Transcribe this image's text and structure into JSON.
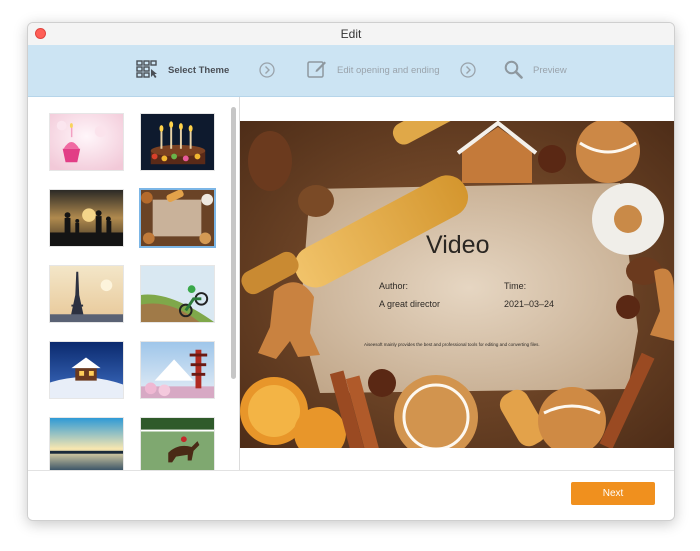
{
  "window": {
    "title": "Edit"
  },
  "steps": [
    {
      "label": "Select Theme",
      "icon": "grid-cursor-icon",
      "state": "active"
    },
    {
      "label": "Edit opening and ending",
      "icon": "edit-icon",
      "state": "inactive"
    },
    {
      "label": "Preview",
      "icon": "search-icon",
      "state": "inactive"
    }
  ],
  "themes": [
    {
      "name": "cupcake",
      "selected": false
    },
    {
      "name": "birthday-cake-candles",
      "selected": false
    },
    {
      "name": "family-sunset",
      "selected": false
    },
    {
      "name": "gingerbread-cookies",
      "selected": true
    },
    {
      "name": "eiffel-tower",
      "selected": false
    },
    {
      "name": "motocross",
      "selected": false
    },
    {
      "name": "snowy-cabin",
      "selected": false
    },
    {
      "name": "japanese-pagoda",
      "selected": false
    },
    {
      "name": "beach-sunset",
      "selected": false
    },
    {
      "name": "horse-racing",
      "selected": false
    }
  ],
  "preview": {
    "title": "Video",
    "author_label": "Author:",
    "author_value": "A great director",
    "time_label": "Time:",
    "time_value": "2021–03–24",
    "description": "Aiseesoft mainly provides the best and professional tools for editing and converting files."
  },
  "footer": {
    "next_label": "Next"
  },
  "colors": {
    "accent": "#f0901e",
    "stepbar": "#cce4f3",
    "selected_border": "#7cb6e6",
    "close": "#ff5f57"
  }
}
